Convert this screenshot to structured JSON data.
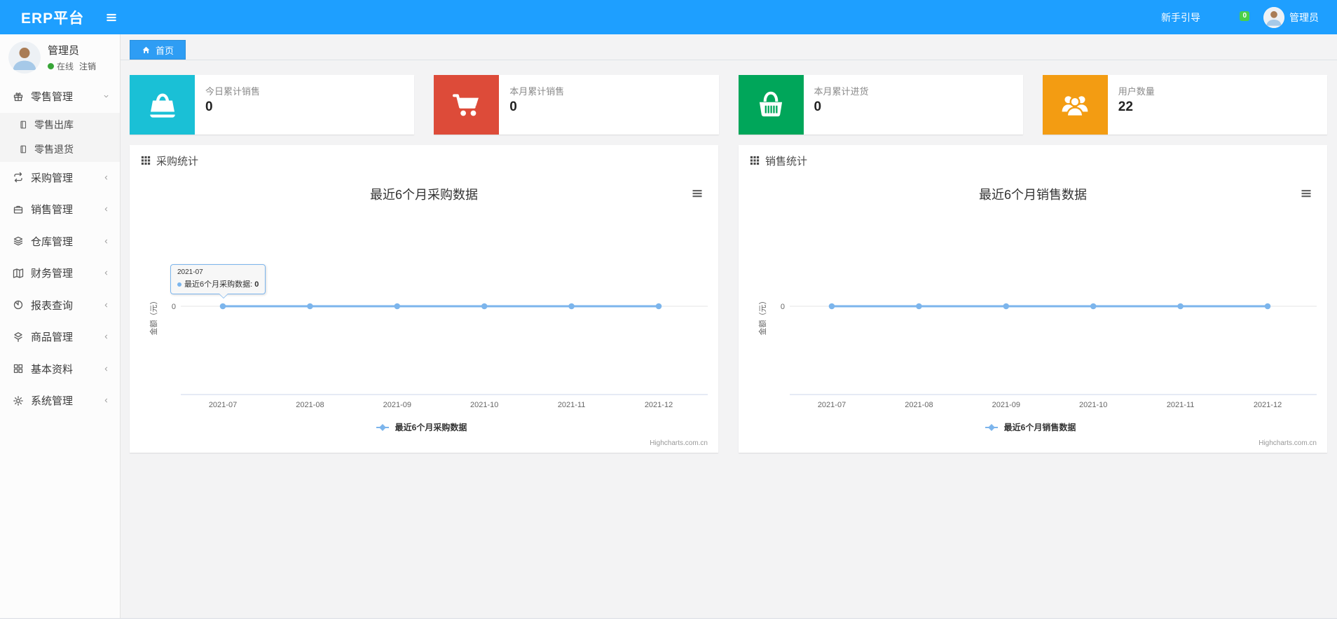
{
  "navbar": {
    "brand": "ERP平台",
    "right": {
      "guide_label": "新手引导",
      "mail_badge": "0",
      "username": "管理员"
    }
  },
  "sidebar": {
    "user": {
      "name": "管理员",
      "status_label": "在线",
      "logout_label": "注销"
    },
    "menu": [
      {
        "label": "零售管理",
        "icon": "gift-icon",
        "expanded": true,
        "children": [
          {
            "label": "零售出库",
            "icon": "journal-icon"
          },
          {
            "label": "零售退货",
            "icon": "journal-icon"
          }
        ]
      },
      {
        "label": "采购管理",
        "icon": "repeat-icon"
      },
      {
        "label": "销售管理",
        "icon": "briefcase-icon"
      },
      {
        "label": "仓库管理",
        "icon": "layers-icon"
      },
      {
        "label": "财务管理",
        "icon": "map-icon"
      },
      {
        "label": "报表查询",
        "icon": "pie-chart-icon"
      },
      {
        "label": "商品管理",
        "icon": "dropbox-icon"
      },
      {
        "label": "基本资料",
        "icon": "grid-icon"
      },
      {
        "label": "系统管理",
        "icon": "gear-icon"
      }
    ]
  },
  "tabs": [
    {
      "label": "首页",
      "icon": "home-icon",
      "active": true
    }
  ],
  "stat_cards": [
    {
      "title": "今日累计销售",
      "value": "0",
      "icon": "shopping-bag-icon",
      "color": "#1AC0D6"
    },
    {
      "title": "本月累计销售",
      "value": "0",
      "icon": "shopping-cart-icon",
      "color": "#DD4B39"
    },
    {
      "title": "本月累计进货",
      "value": "0",
      "icon": "shopping-basket-icon",
      "color": "#00A65A"
    },
    {
      "title": "用户数量",
      "value": "22",
      "icon": "users-icon",
      "color": "#F39C12"
    }
  ],
  "panels": [
    {
      "title": "采购统计",
      "icon": "th-grid-icon"
    },
    {
      "title": "销售统计",
      "icon": "th-grid-icon"
    }
  ],
  "chart_data": [
    {
      "type": "line",
      "title": "最近6个月采购数据",
      "categories": [
        "2021-07",
        "2021-08",
        "2021-09",
        "2021-10",
        "2021-11",
        "2021-12"
      ],
      "series": [
        {
          "name": "最近6个月采购数据",
          "values": [
            0,
            0,
            0,
            0,
            0,
            0
          ],
          "color": "#7cb5ec"
        }
      ],
      "ylabel": "金额（元）",
      "yticks": [
        "0"
      ],
      "ylim": [
        -1,
        1
      ],
      "grid": "zero-line-only",
      "legend_position": "bottom",
      "credits": "Highcharts.com.cn",
      "tooltip": {
        "visible": true,
        "header": "2021-07",
        "series_label": "最近6个月采购数据:",
        "value": "0",
        "point_index": 0
      }
    },
    {
      "type": "line",
      "title": "最近6个月销售数据",
      "categories": [
        "2021-07",
        "2021-08",
        "2021-09",
        "2021-10",
        "2021-11",
        "2021-12"
      ],
      "series": [
        {
          "name": "最近6个月销售数据",
          "values": [
            0,
            0,
            0,
            0,
            0,
            0
          ],
          "color": "#7cb5ec"
        }
      ],
      "ylabel": "金额（元）",
      "yticks": [
        "0"
      ],
      "ylim": [
        -1,
        1
      ],
      "grid": "zero-line-only",
      "legend_position": "bottom",
      "credits": "Highcharts.com.cn",
      "tooltip": {
        "visible": false
      }
    }
  ]
}
